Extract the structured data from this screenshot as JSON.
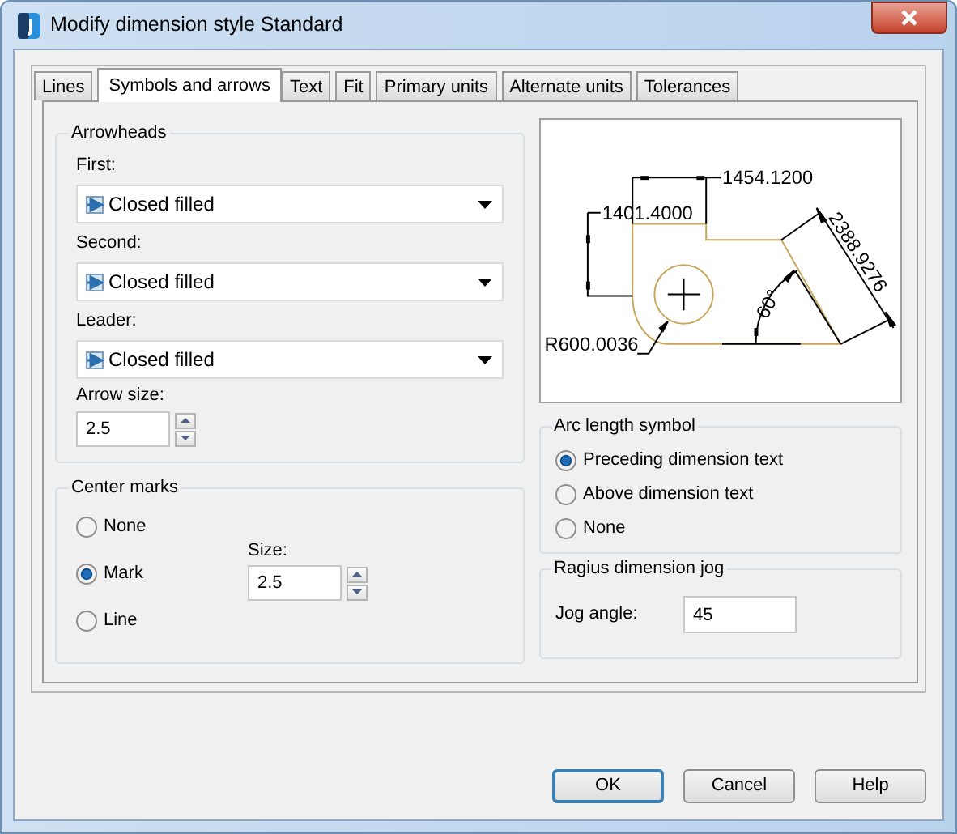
{
  "window": {
    "title": "Modify dimension style Standard"
  },
  "tabs": [
    {
      "label": "Lines",
      "selected": false
    },
    {
      "label": "Symbols and arrows",
      "selected": true
    },
    {
      "label": "Text",
      "selected": false
    },
    {
      "label": "Fit",
      "selected": false
    },
    {
      "label": "Primary units",
      "selected": false
    },
    {
      "label": "Alternate units",
      "selected": false
    },
    {
      "label": "Tolerances",
      "selected": false
    }
  ],
  "arrowheads": {
    "title": "Arrowheads",
    "fields": [
      {
        "label": "First:",
        "value": "Closed filled"
      },
      {
        "label": "Second:",
        "value": "Closed filled"
      },
      {
        "label": "Leader:",
        "value": "Closed filled"
      }
    ],
    "arrow_size": {
      "label": "Arrow size:",
      "value": "2.5"
    }
  },
  "center_marks": {
    "title": "Center marks",
    "options": [
      {
        "label": "None",
        "selected": false
      },
      {
        "label": "Mark",
        "selected": true
      },
      {
        "label": "Line",
        "selected": false
      }
    ],
    "size": {
      "label": "Size:",
      "value": "2.5"
    }
  },
  "preview": {
    "labels": [
      "1454.1200",
      "1401.4000",
      "2388.9276",
      "60°",
      "R600.0036"
    ]
  },
  "arc_length_symbol": {
    "title": "Arc length symbol",
    "options": [
      {
        "label": "Preceding dimension text",
        "selected": true
      },
      {
        "label": "Above dimension text",
        "selected": false
      },
      {
        "label": "None",
        "selected": false
      }
    ]
  },
  "radius_jog": {
    "title": "Ragius dimension jog",
    "label": "Jog angle:",
    "value": "45"
  },
  "buttons": [
    {
      "label": "OK",
      "default": true
    },
    {
      "label": "Cancel",
      "default": false
    },
    {
      "label": "Help",
      "default": false
    }
  ]
}
